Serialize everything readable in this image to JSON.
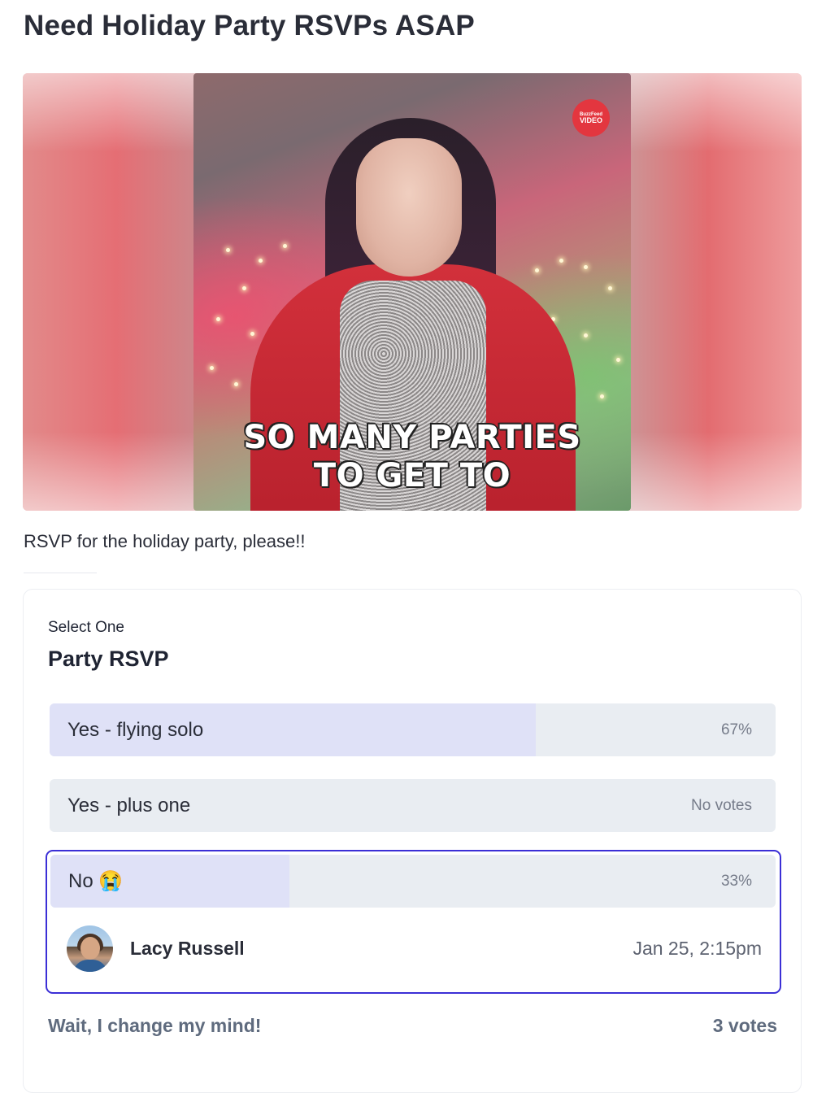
{
  "post": {
    "title": "Need Holiday Party RSVPs ASAP",
    "description": "RSVP for the holiday party, please!!"
  },
  "gif": {
    "caption_line1": "SO MANY PARTIES",
    "caption_line2": "TO GET TO",
    "badge_line1": "BuzzFeed",
    "badge_line2": "VIDEO"
  },
  "poll": {
    "kind": "Select One",
    "title": "Party RSVP",
    "options": [
      {
        "label": "Yes - flying solo",
        "stat": "67%",
        "share": 0.67
      },
      {
        "label": "Yes - plus one",
        "stat": "No votes",
        "share": 0
      },
      {
        "label": "No 😭",
        "stat": "33%",
        "share": 0.33,
        "selected": true
      }
    ],
    "voter": {
      "name": "Lacy Russell",
      "time": "Jan 25, 2:15pm"
    },
    "change_label": "Wait, I change my mind!",
    "total": "3 votes"
  },
  "colors": {
    "accent": "#3b2fd6",
    "fill": "#dfe1f7",
    "track": "#e9edf2"
  }
}
